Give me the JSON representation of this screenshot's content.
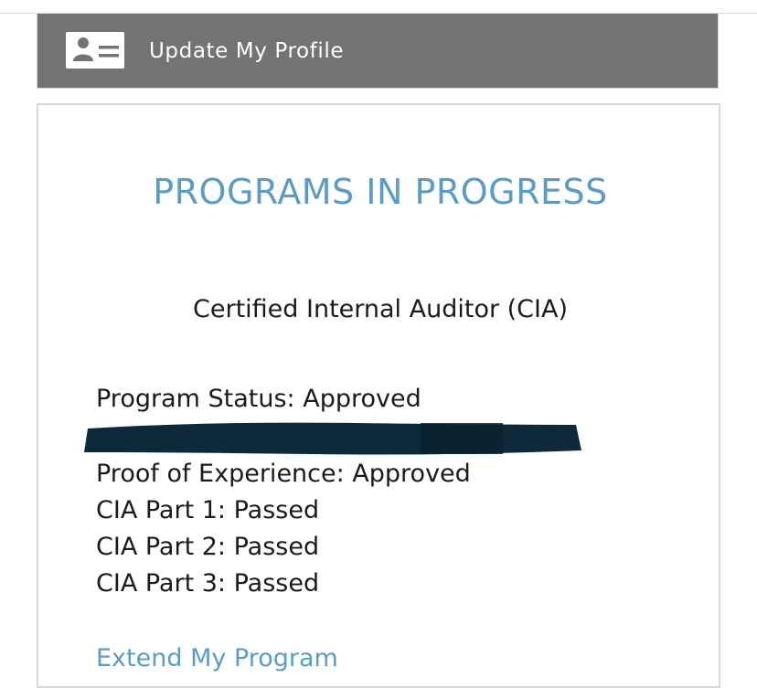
{
  "profile_bar": {
    "label": "Update My Profile",
    "icon": "profile-card-icon",
    "background_color": "#737373"
  },
  "card": {
    "title": "PROGRAMS IN PROGRESS",
    "title_color": "#5b9bc4",
    "program_name": "Certified Internal Auditor (CIA)",
    "status_lines": [
      "Program Status: Approved",
      "Proof of Experience: Approved",
      "CIA Part 1: Passed",
      "CIA Part 2: Passed",
      "CIA Part 3: Passed"
    ],
    "redacted_line": true,
    "enroll_link": "Extend My Program"
  }
}
